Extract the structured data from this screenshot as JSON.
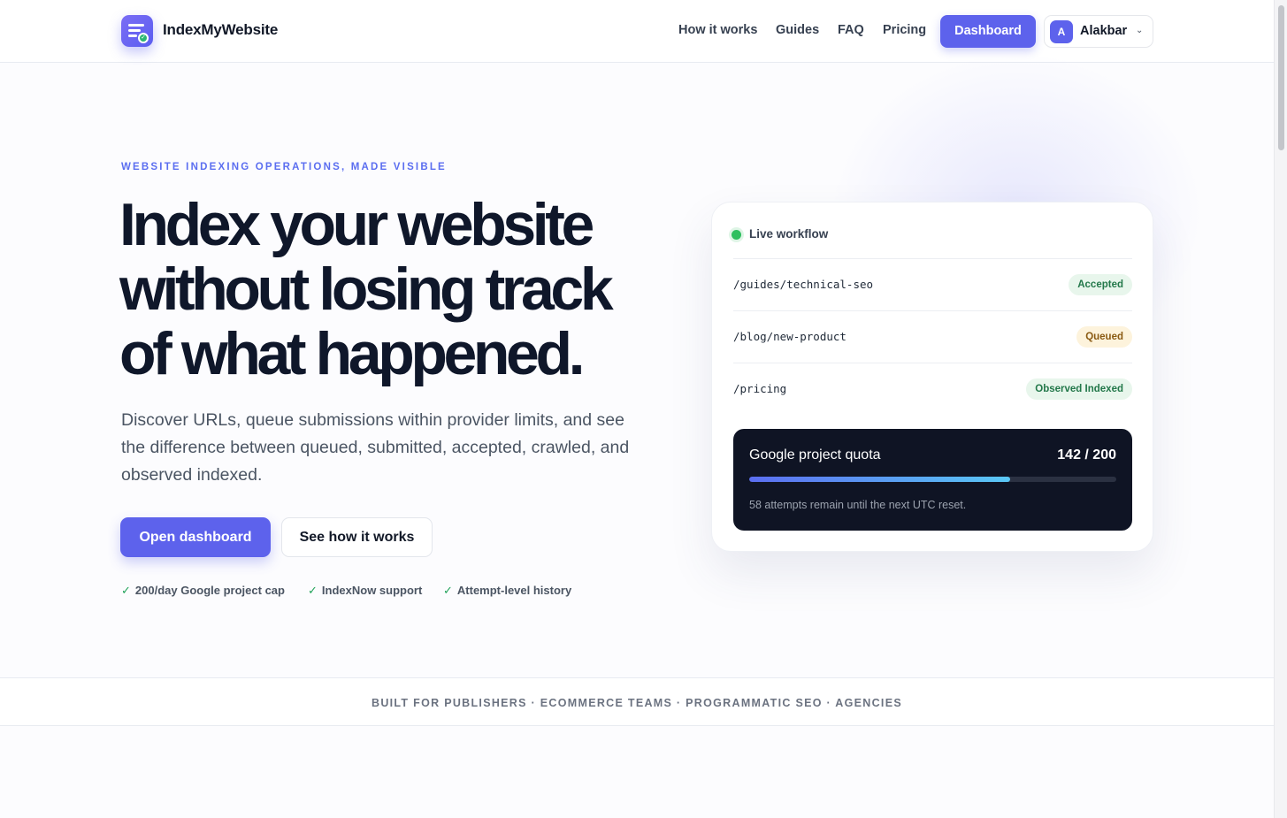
{
  "header": {
    "brand": "IndexMyWebsite",
    "nav": [
      "How it works",
      "Guides",
      "FAQ",
      "Pricing"
    ],
    "dashboard_label": "Dashboard",
    "user": {
      "initial": "A",
      "name": "Alakbar"
    }
  },
  "hero": {
    "eyebrow": "WEBSITE INDEXING OPERATIONS, MADE VISIBLE",
    "headline": "Index your website without losing track of what happened.",
    "subtext": "Discover URLs, queue submissions within provider limits, and see the difference between queued, submitted, accepted, crawled, and observed indexed.",
    "primary_cta": "Open dashboard",
    "secondary_cta": "See how it works",
    "features": [
      "200/day Google project cap",
      "IndexNow support",
      "Attempt-level history"
    ]
  },
  "workflow": {
    "title": "Live workflow",
    "rows": [
      {
        "path": "/guides/technical-seo",
        "status": "Accepted"
      },
      {
        "path": "/blog/new-product",
        "status": "Queued"
      },
      {
        "path": "/pricing",
        "status": "Observed Indexed"
      }
    ],
    "quota": {
      "title": "Google project quota",
      "used": 142,
      "total": 200,
      "count_label": "142 / 200",
      "note": "58 attempts remain until the next UTC reset."
    }
  },
  "audience": "BUILT FOR PUBLISHERS · ECOMMERCE TEAMS · PROGRAMMATIC SEO · AGENCIES",
  "colors": {
    "accent": "#5d62ec",
    "status_green": "#23784a",
    "status_yellow": "#8a5a12",
    "quota_bg": "#0f1424"
  }
}
